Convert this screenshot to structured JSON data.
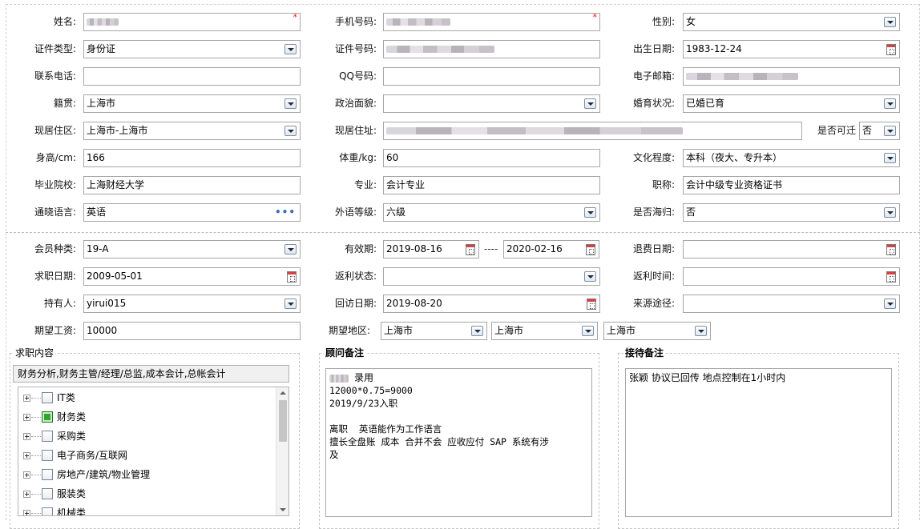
{
  "personal": {
    "name_label": "姓名:",
    "mobile_label": "手机号码:",
    "gender_label": "性别:",
    "gender_value": "女",
    "id_type_label": "证件类型:",
    "id_type_value": "身份证",
    "id_number_label": "证件号码:",
    "birth_label": "出生日期:",
    "birth_value": "1983-12-24",
    "phone_label": "联系电话:",
    "phone_value": "",
    "qq_label": "QQ号码:",
    "qq_value": "",
    "email_label": "电子邮箱:",
    "native_label": "籍贯:",
    "native_value": "上海市",
    "political_label": "政治面貌:",
    "political_value": "",
    "marital_label": "婚育状况:",
    "marital_value": "已婚已育",
    "residence_label": "现居住区:",
    "residence_value": "上海市-上海市",
    "address_label": "现居住址:",
    "relocate_label": "是否可迁",
    "relocate_value": "否",
    "height_label": "身高/cm:",
    "height_value": "166",
    "weight_label": "体重/kg:",
    "weight_value": "60",
    "education_label": "文化程度:",
    "education_value": "本科（夜大、专升本）",
    "school_label": "毕业院校:",
    "school_value": "上海财经大学",
    "major_label": "专业:",
    "major_value": "会计专业",
    "title_label": "职称:",
    "title_value": "会计中级专业资格证书",
    "language_label": "通晓语言:",
    "language_value": "英语",
    "language_level_label": "外语等级:",
    "language_level_value": "六级",
    "returnee_label": "是否海归:",
    "returnee_value": "否"
  },
  "membership": {
    "member_type_label": "会员种类:",
    "member_type_value": "19-A",
    "valid_label": "有效期:",
    "valid_from": "2019-08-16",
    "valid_sep": "----",
    "valid_to": "2020-02-16",
    "refund_date_label": "退费日期:",
    "refund_date_value": "",
    "job_date_label": "求职日期:",
    "job_date_value": "2009-05-01",
    "rebate_status_label": "返利状态:",
    "rebate_status_value": "",
    "rebate_time_label": "返利时间:",
    "rebate_time_value": "",
    "holder_label": "持有人:",
    "holder_value": "yirui015",
    "visit_date_label": "回访日期:",
    "visit_date_value": "2019-08-20",
    "source_label": "来源途径:",
    "source_value": "",
    "salary_label": "期望工资:",
    "salary_value": "10000",
    "region_label": "期望地区:",
    "region_1": "上海市",
    "region_2": "上海市",
    "region_3": "上海市"
  },
  "job_content": {
    "title": "求职内容",
    "selected": "财务分析,财务主管/经理/总监,成本会计,总帐会计",
    "tree": [
      "IT类",
      "财务类",
      "采购类",
      "电子商务/互联网",
      "房地产/建筑/物业管理",
      "服装类",
      "机械类"
    ],
    "checked": [
      false,
      true,
      false,
      false,
      false,
      false,
      false
    ]
  },
  "advisor_notes": {
    "title": "顾问备注",
    "line1": "录用",
    "body": "12000*0.75=9000\n2019/9/23入职\n\n离职  英语能作为工作语言\n擅长全盘账 成本 合并不会 应收应付 SAP 系统有涉\n及"
  },
  "reception_notes": {
    "title": "接待备注",
    "body": "张颖 协议已回传 地点控制在1小时内"
  },
  "colors": {
    "required_mark": "#ff0000",
    "checked_box": "#2ea82a",
    "border": "#a6a6a6"
  },
  "marks": {
    "required": "*"
  }
}
